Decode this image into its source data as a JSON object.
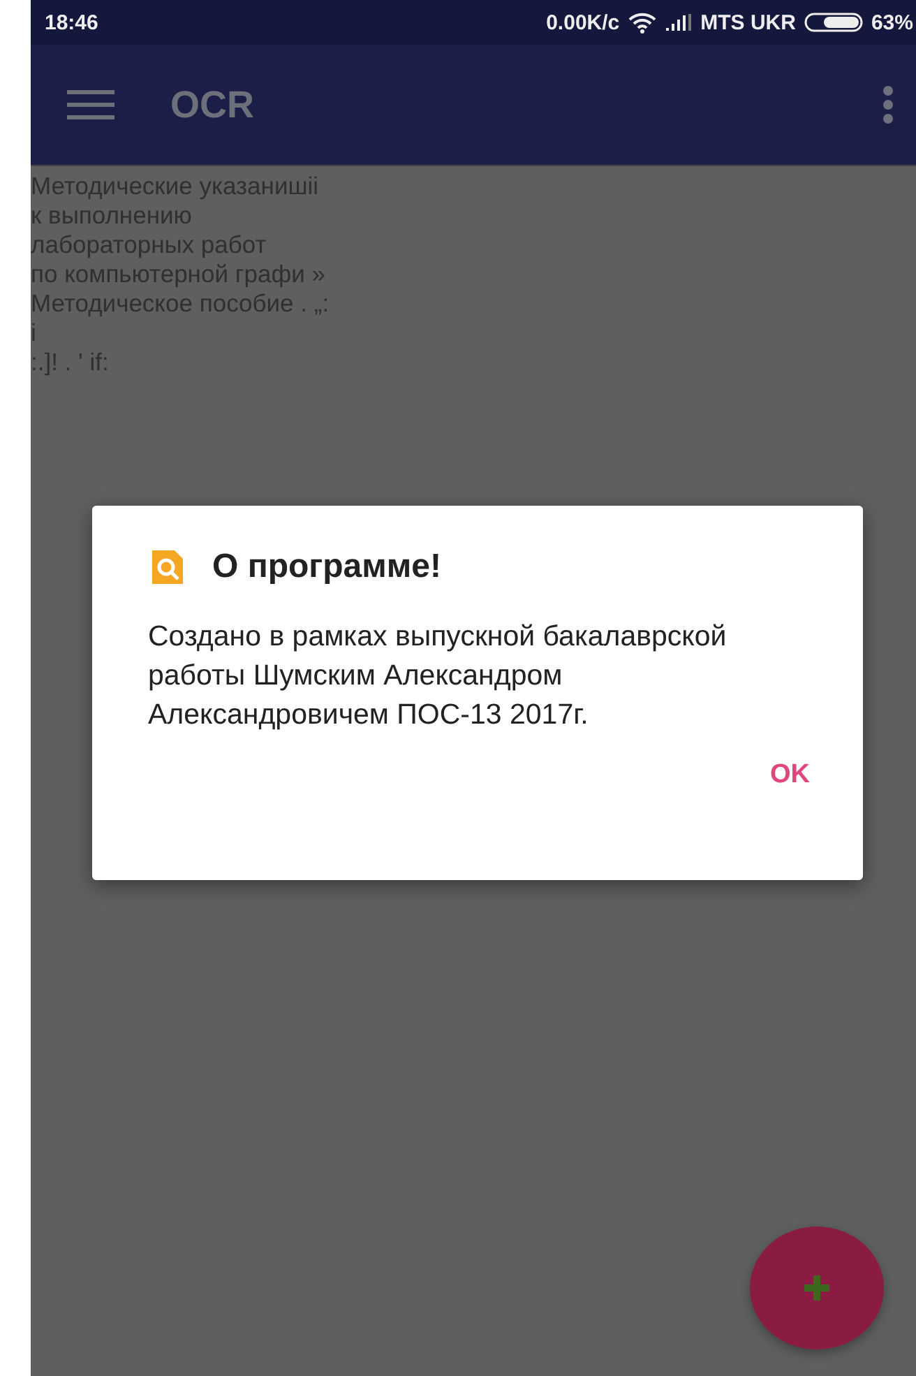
{
  "status_bar": {
    "time": "18:46",
    "speed": "0.00K/c",
    "carrier": "MTS UKR",
    "battery": "63%"
  },
  "app_bar": {
    "title": "OCR"
  },
  "recognized_text": [
    "Методические указанишіі",
    "к выполнению",
    "лабораторных работ",
    "по компьютерной графи »",
    "Методическое пособие . „:",
    "i",
    ":.]! . ' if:"
  ],
  "dialog": {
    "title": "О программе!",
    "message": "Создано в рамках выпускной бакалаврской работы Шумским Александром Александровичем ПОС-13 2017г.",
    "buttons": [
      "OK"
    ]
  }
}
